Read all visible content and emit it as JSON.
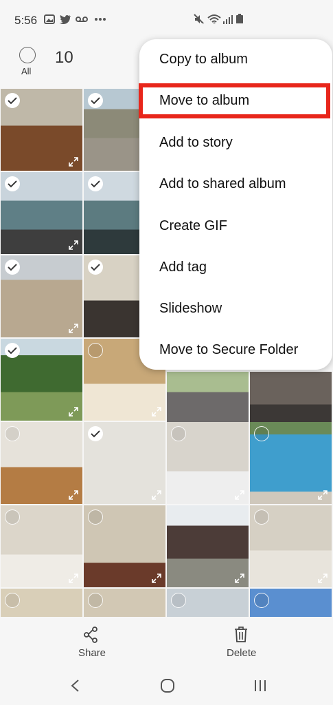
{
  "status_bar": {
    "time": "5:56",
    "left_icons": [
      "gallery-icon",
      "twitter-icon",
      "voicemail-icon",
      "more-dots-icon"
    ],
    "right_icons": [
      "mute-icon",
      "wifi-icon",
      "signal-icon",
      "battery-icon"
    ]
  },
  "selection": {
    "all_label": "All",
    "count": "10"
  },
  "menu": {
    "items": [
      "Copy to album",
      "Move to album",
      "Add to story",
      "Add to shared album",
      "Create GIF",
      "Add tag",
      "Slideshow",
      "Move to Secure Folder"
    ],
    "highlighted": "Move to album",
    "highlight_color": "#e8261b"
  },
  "photos": {
    "tiles": [
      {
        "subject": "empty room with wood floor",
        "checked": true
      },
      {
        "subject": "beach house",
        "checked": true
      },
      {
        "subject": "pier",
        "checked": true
      },
      {
        "subject": "beach",
        "checked": true
      },
      {
        "subject": "beach walkway",
        "checked": true
      },
      {
        "subject": "interior",
        "checked": true
      },
      {
        "subject": "tree in yard",
        "checked": true
      },
      {
        "subject": "bathroom sink",
        "checked": false
      },
      {
        "subject": "patio",
        "checked": false
      },
      {
        "subject": "living room sofa",
        "checked": false
      },
      {
        "subject": "dining table",
        "checked": false
      },
      {
        "subject": "shower",
        "checked": true
      },
      {
        "subject": "bathroom vanity",
        "checked": false
      },
      {
        "subject": "swimming pool",
        "checked": false
      },
      {
        "subject": "fireplace living room",
        "checked": false
      },
      {
        "subject": "front door",
        "checked": false
      },
      {
        "subject": "house exterior",
        "checked": false
      },
      {
        "subject": "bedroom",
        "checked": false
      },
      {
        "subject": "room",
        "checked": false
      },
      {
        "subject": "doorway",
        "checked": false
      },
      {
        "subject": "street",
        "checked": false
      },
      {
        "subject": "mural",
        "checked": false
      }
    ]
  },
  "bottom_bar": {
    "share_label": "Share",
    "delete_label": "Delete"
  },
  "nav_bar": {
    "icons": [
      "back-icon",
      "home-icon",
      "recents-icon"
    ]
  }
}
